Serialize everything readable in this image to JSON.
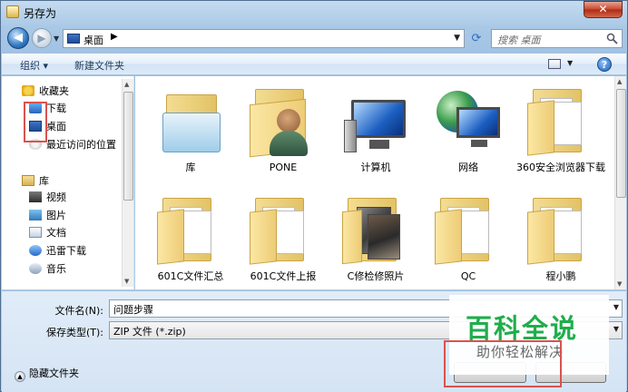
{
  "window": {
    "title": "另存为",
    "close_label": "✕"
  },
  "nav": {
    "address": "桌面",
    "search_placeholder": "搜索 桌面"
  },
  "toolbar": {
    "organize_label": "组织 ▾",
    "new_folder_label": "新建文件夹"
  },
  "sidebar": {
    "favorites_label": "收藏夹",
    "items": [
      {
        "label": "下载",
        "icon": "download-icon"
      },
      {
        "label": "桌面",
        "icon": "desktop-icon"
      },
      {
        "label": "最近访问的位置",
        "icon": "recent-places-icon"
      }
    ],
    "libraries_label": "库",
    "library_items": [
      {
        "label": "视频",
        "icon": "video-icon"
      },
      {
        "label": "图片",
        "icon": "picture-icon"
      },
      {
        "label": "文档",
        "icon": "document-icon"
      },
      {
        "label": "迅雷下载",
        "icon": "thunder-icon"
      },
      {
        "label": "音乐",
        "icon": "music-icon"
      }
    ]
  },
  "files": [
    {
      "name": "库",
      "icon": "library-folder-icon"
    },
    {
      "name": "PONE",
      "icon": "user-folder-icon"
    },
    {
      "name": "计算机",
      "icon": "computer-icon"
    },
    {
      "name": "网络",
      "icon": "network-icon"
    },
    {
      "name": "360安全浏览器下载",
      "icon": "folder-icon"
    },
    {
      "name": "601C文件汇总",
      "icon": "folder-icon"
    },
    {
      "name": "601C文件上报",
      "icon": "folder-icon"
    },
    {
      "name": "C修检修照片",
      "icon": "photo-folder-icon"
    },
    {
      "name": "QC",
      "icon": "folder-icon"
    },
    {
      "name": "程小鹏",
      "icon": "folder-icon"
    }
  ],
  "form": {
    "filename_label": "文件名(N):",
    "filename_value": "问题步骤",
    "filetype_label": "保存类型(T):",
    "filetype_value": "ZIP 文件 (*.zip)",
    "hide_folders_label": "隐藏文件夹"
  },
  "watermark": {
    "title": "百科全说",
    "subtitle": "助你轻松解决"
  },
  "colors": {
    "accent": "#2f78c4",
    "annotation": "#d9534f",
    "watermark_green": "#1fae4b"
  }
}
